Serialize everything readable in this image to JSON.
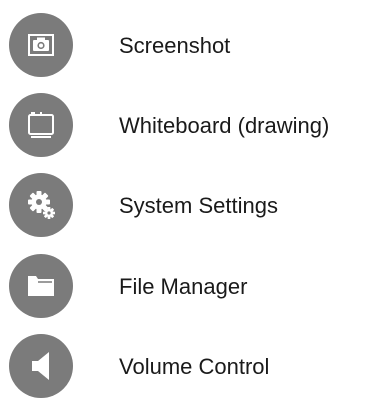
{
  "menu": {
    "items": [
      {
        "label": "Screenshot",
        "icon": "camera-icon"
      },
      {
        "label": "Whiteboard (drawing)",
        "icon": "whiteboard-icon"
      },
      {
        "label": "System Settings",
        "icon": "gear-icon"
      },
      {
        "label": "File Manager",
        "icon": "folder-icon"
      },
      {
        "label": "Volume Control",
        "icon": "speaker-icon"
      }
    ]
  },
  "colors": {
    "icon_background": "#7b7b7b",
    "icon_foreground": "#ffffff",
    "label_text": "#1a1a1a"
  }
}
